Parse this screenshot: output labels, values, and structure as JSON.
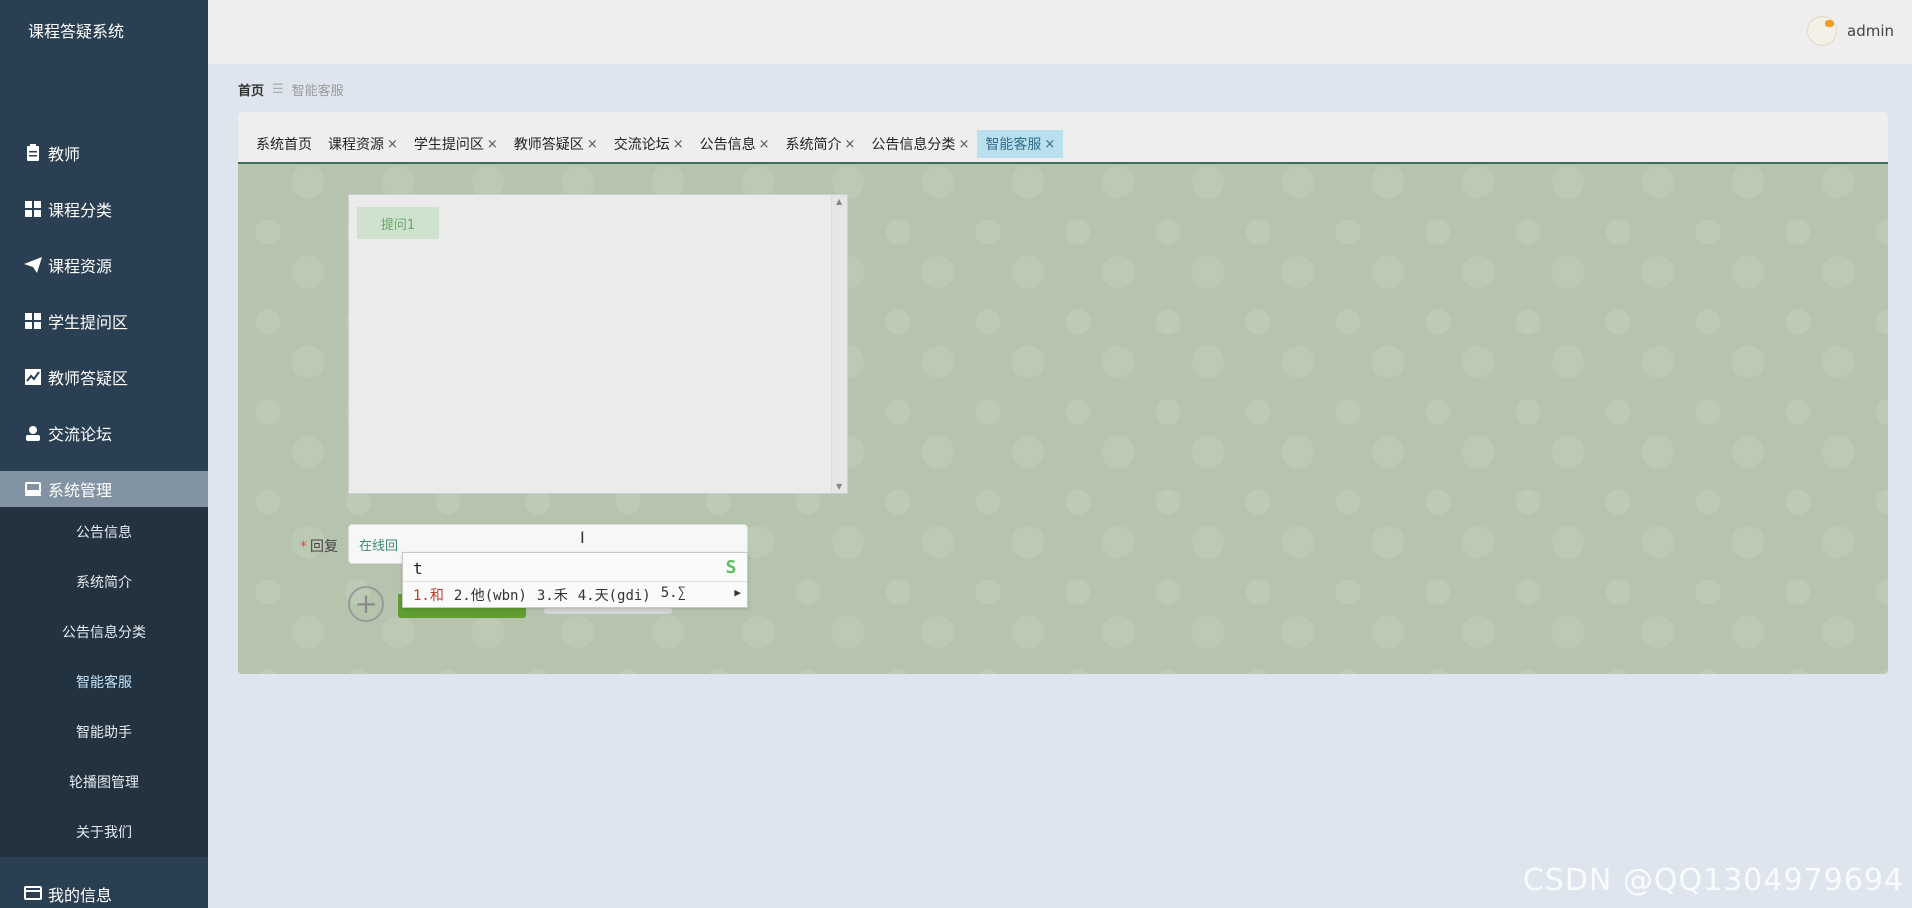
{
  "app": {
    "title": "课程答疑系统"
  },
  "sidebar": {
    "items": [
      {
        "label": "教师",
        "icon": "clipboard-icon"
      },
      {
        "label": "课程分类",
        "icon": "grid-icon"
      },
      {
        "label": "课程资源",
        "icon": "paper-plane-icon"
      },
      {
        "label": "学生提问区",
        "icon": "grid-icon"
      },
      {
        "label": "教师答疑区",
        "icon": "chart-line-icon"
      },
      {
        "label": "交流论坛",
        "icon": "user-icon"
      },
      {
        "label": "系统管理",
        "icon": "inbox-icon"
      }
    ],
    "submenu": [
      "公告信息",
      "系统简介",
      "公告信息分类",
      "智能客服",
      "智能助手",
      "轮播图管理",
      "关于我们"
    ],
    "bottom": {
      "label": "我的信息",
      "icon": "card-icon"
    }
  },
  "header": {
    "username": "admin"
  },
  "breadcrumb": {
    "home": "首页",
    "current": "智能客服"
  },
  "tabs": [
    {
      "label": "系统首页",
      "closable": false
    },
    {
      "label": "课程资源",
      "closable": true
    },
    {
      "label": "学生提问区",
      "closable": true
    },
    {
      "label": "教师答疑区",
      "closable": true
    },
    {
      "label": "交流论坛",
      "closable": true
    },
    {
      "label": "公告信息",
      "closable": true
    },
    {
      "label": "系统简介",
      "closable": true
    },
    {
      "label": "公告信息分类",
      "closable": true
    },
    {
      "label": "智能客服",
      "closable": true
    }
  ],
  "close_glyph": "×",
  "chat": {
    "messages": [
      "提问1"
    ]
  },
  "reply": {
    "label": "回复",
    "value": "在线回",
    "required_mark": "*"
  },
  "ime": {
    "input": "t",
    "candidates": [
      "1.和",
      "2.他(wbn)",
      "3.禾",
      "4.天(gdi)",
      "5.∑"
    ],
    "logo": "S"
  },
  "watermark": "CSDN @QQ1304979694",
  "colors": {
    "sidebar": "#2a3f52",
    "active_tab": "#b9e0ee",
    "send_button": "#5e9d2f"
  }
}
